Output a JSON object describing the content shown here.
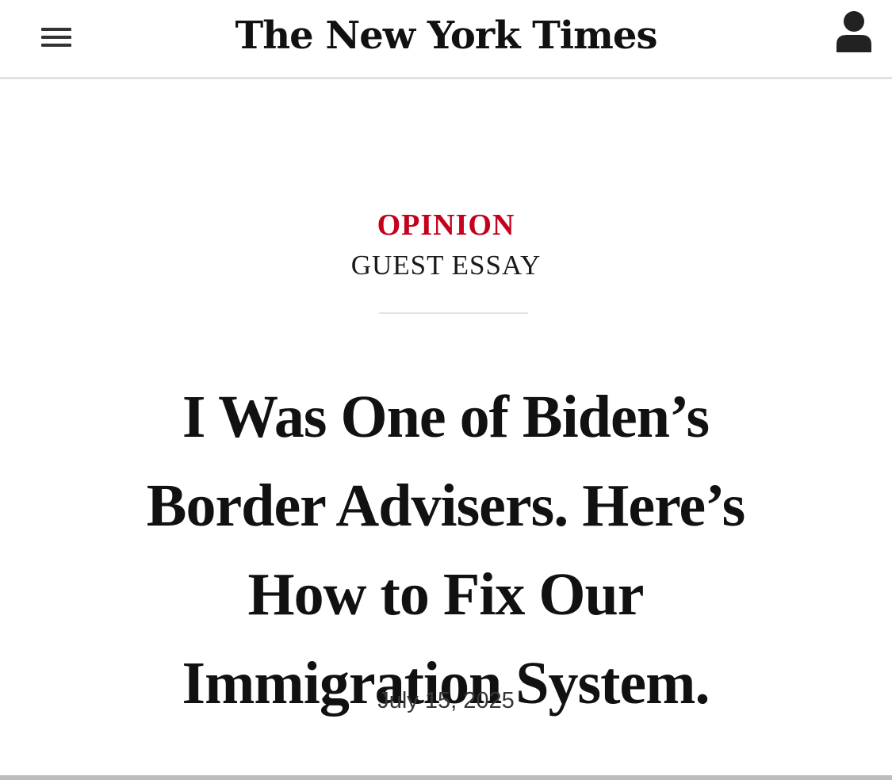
{
  "header": {
    "menu_icon": "hamburger-menu-icon",
    "masthead": "The New York Times",
    "account_icon": "person-icon"
  },
  "article": {
    "section": "OPINION",
    "section_color": "#c4001c",
    "type": "GUEST ESSAY",
    "headline": "I Was One of Biden’s Border Advisers. Here’s How to Fix Our Immigration System.",
    "date": "July 15, 2025"
  }
}
